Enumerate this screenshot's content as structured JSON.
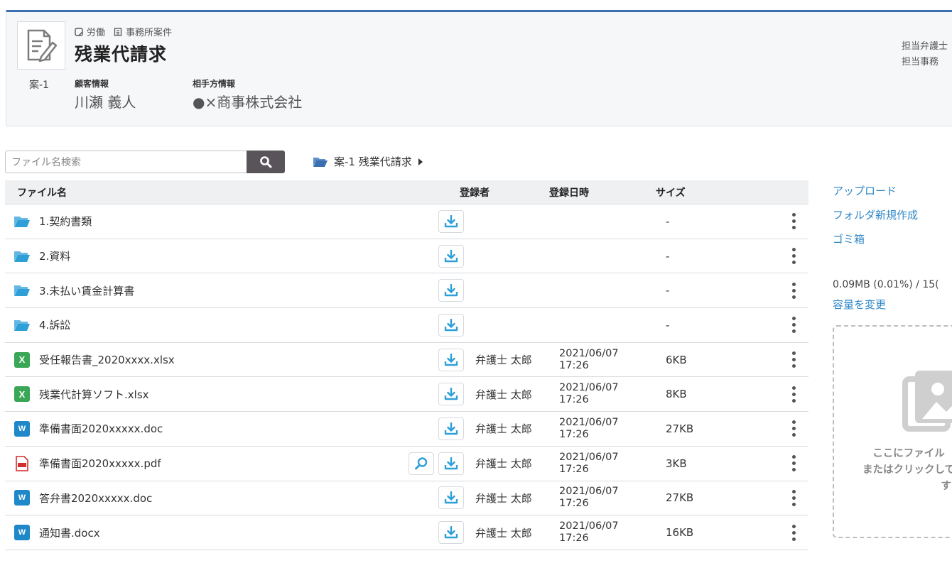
{
  "case": {
    "tag_category": "労働",
    "tag_type": "事務所案件",
    "title": "残業代請求",
    "number": "案-1",
    "client_label": "顧客情報",
    "client_name": "川瀬 義人",
    "opponent_label": "相手方情報",
    "opponent_name": "●×商事株式会社",
    "staff_lawyer_label": "担当弁護士",
    "staff_clerk_label": "担当事務"
  },
  "search": {
    "placeholder": "ファイル名検索"
  },
  "breadcrumb": {
    "path": "案-1 残業代請求"
  },
  "table": {
    "headers": {
      "name": "ファイル名",
      "user": "登録者",
      "date": "登録日時",
      "size": "サイズ"
    },
    "rows": [
      {
        "type": "folder",
        "name": "1.契約書類",
        "user": "",
        "date": "",
        "time": "",
        "size": "-",
        "preview": false
      },
      {
        "type": "folder",
        "name": "2.資料",
        "user": "",
        "date": "",
        "time": "",
        "size": "-",
        "preview": false
      },
      {
        "type": "folder",
        "name": "3.未払い賃金計算書",
        "user": "",
        "date": "",
        "time": "",
        "size": "-",
        "preview": false
      },
      {
        "type": "folder",
        "name": "4.訴訟",
        "user": "",
        "date": "",
        "time": "",
        "size": "-",
        "preview": false
      },
      {
        "type": "excel",
        "name": "受任報告書_2020xxxx.xlsx",
        "user": "弁護士 太郎",
        "date": "2021/06/07",
        "time": "17:26",
        "size": "6KB",
        "preview": false
      },
      {
        "type": "excel",
        "name": "残業代計算ソフト.xlsx",
        "user": "弁護士 太郎",
        "date": "2021/06/07",
        "time": "17:26",
        "size": "8KB",
        "preview": false
      },
      {
        "type": "word",
        "name": "準備書面2020xxxxx.doc",
        "user": "弁護士 太郎",
        "date": "2021/06/07",
        "time": "17:26",
        "size": "27KB",
        "preview": false
      },
      {
        "type": "pdf",
        "name": "準備書面2020xxxxx.pdf",
        "user": "弁護士 太郎",
        "date": "2021/06/07",
        "time": "17:26",
        "size": "3KB",
        "preview": true
      },
      {
        "type": "word",
        "name": "答弁書2020xxxxx.doc",
        "user": "弁護士 太郎",
        "date": "2021/06/07",
        "time": "17:26",
        "size": "27KB",
        "preview": false
      },
      {
        "type": "word",
        "name": "通知書.docx",
        "user": "弁護士 太郎",
        "date": "2021/06/07",
        "time": "17:26",
        "size": "16KB",
        "preview": false
      }
    ]
  },
  "side": {
    "upload": "アップロード",
    "new_folder": "フォルダ新規作成",
    "trash": "ゴミ箱",
    "usage": "0.09MB (0.01%) / 15(",
    "change_capacity": "容量を変更",
    "dropzone_line1": "ここにファイル",
    "dropzone_line2": "またはクリックして",
    "dropzone_line3": "する"
  },
  "colors": {
    "accent": "#3a6fb0",
    "link": "#2f86c7",
    "folder": "#2f9fd8",
    "excel": "#3aa757",
    "word": "#1e88c9",
    "pdf": "#d32f2f",
    "search_button": "#59545a"
  },
  "icons": {
    "case": "document-pen-icon",
    "folder": "folder-open-icon",
    "download": "download-icon",
    "preview": "magnifier-icon",
    "menu": "kebab-menu-icon",
    "dropzone": "image-placeholder-icon"
  }
}
